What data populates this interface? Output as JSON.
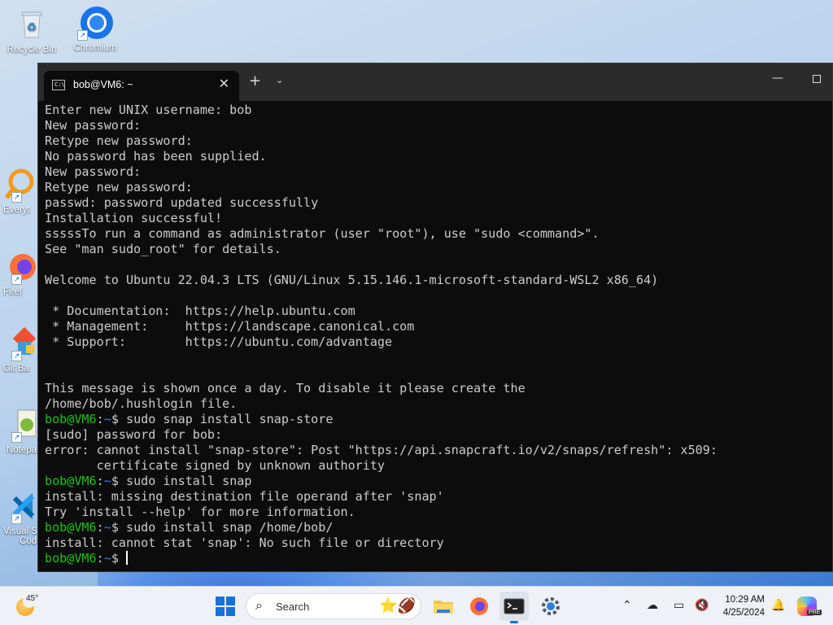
{
  "desktop": {
    "icons": [
      {
        "label": "Recycle Bin"
      },
      {
        "label": "Chromium"
      },
      {
        "label": "Everyt"
      },
      {
        "label": "Firef"
      },
      {
        "label": "Git Ba"
      },
      {
        "label": "Notepa"
      },
      {
        "label": "Visual S"
      },
      {
        "label": "Cod"
      }
    ]
  },
  "terminal": {
    "tab_title": "bob@VM6: ~",
    "tab_icon_text": "C:\\",
    "lines": [
      {
        "text": "Enter new UNIX username: bob"
      },
      {
        "text": "New password:"
      },
      {
        "text": "Retype new password:"
      },
      {
        "text": "No password has been supplied."
      },
      {
        "text": "New password:"
      },
      {
        "text": "Retype new password:"
      },
      {
        "text": "passwd: password updated successfully"
      },
      {
        "text": "Installation successful!"
      },
      {
        "text": "sssssTo run a command as administrator (user \"root\"), use \"sudo <command>\"."
      },
      {
        "text": "See \"man sudo_root\" for details."
      },
      {
        "text": ""
      },
      {
        "text": "Welcome to Ubuntu 22.04.3 LTS (GNU/Linux 5.15.146.1-microsoft-standard-WSL2 x86_64)"
      },
      {
        "text": ""
      },
      {
        "text": " * Documentation:  https://help.ubuntu.com"
      },
      {
        "text": " * Management:     https://landscape.canonical.com"
      },
      {
        "text": " * Support:        https://ubuntu.com/advantage"
      },
      {
        "text": ""
      },
      {
        "text": ""
      },
      {
        "text": "This message is shown once a day. To disable it please create the"
      },
      {
        "text": "/home/bob/.hushlogin file."
      },
      {
        "prompt": true,
        "text": " sudo snap install snap-store"
      },
      {
        "text": "[sudo] password for bob:"
      },
      {
        "text": "error: cannot install \"snap-store\": Post \"https://api.snapcraft.io/v2/snaps/refresh\": x509:"
      },
      {
        "text": "       certificate signed by unknown authority"
      },
      {
        "prompt": true,
        "text": " sudo install snap"
      },
      {
        "text": "install: missing destination file operand after 'snap'"
      },
      {
        "text": "Try 'install --help' for more information."
      },
      {
        "prompt": true,
        "text": " sudo install snap /home/bob/"
      },
      {
        "text": "install: cannot stat 'snap': No such file or directory"
      },
      {
        "prompt": true,
        "text": " ",
        "cursor": true
      }
    ],
    "prompt_user": "bob@VM6",
    "prompt_sep": ":",
    "prompt_path": "~",
    "prompt_end": "$",
    "colors": {
      "background": "#0c0c0c",
      "text": "#cccccc",
      "prompt_user": "#16c60c",
      "prompt_path": "#3b78ff"
    }
  },
  "taskbar": {
    "weather_temp": "45°",
    "search_placeholder": "Search",
    "time": "10:29 AM",
    "date": "4/25/2024",
    "copilot_badge": "PRE",
    "icons": [
      "windows-start-icon",
      "search-icon",
      "file-explorer-icon",
      "firefox-icon",
      "terminal-icon",
      "settings-icon",
      "chevron-up-icon",
      "cloud-offline-icon",
      "display-icon",
      "volume-muted-icon",
      "bell-icon",
      "copilot-icon"
    ]
  }
}
